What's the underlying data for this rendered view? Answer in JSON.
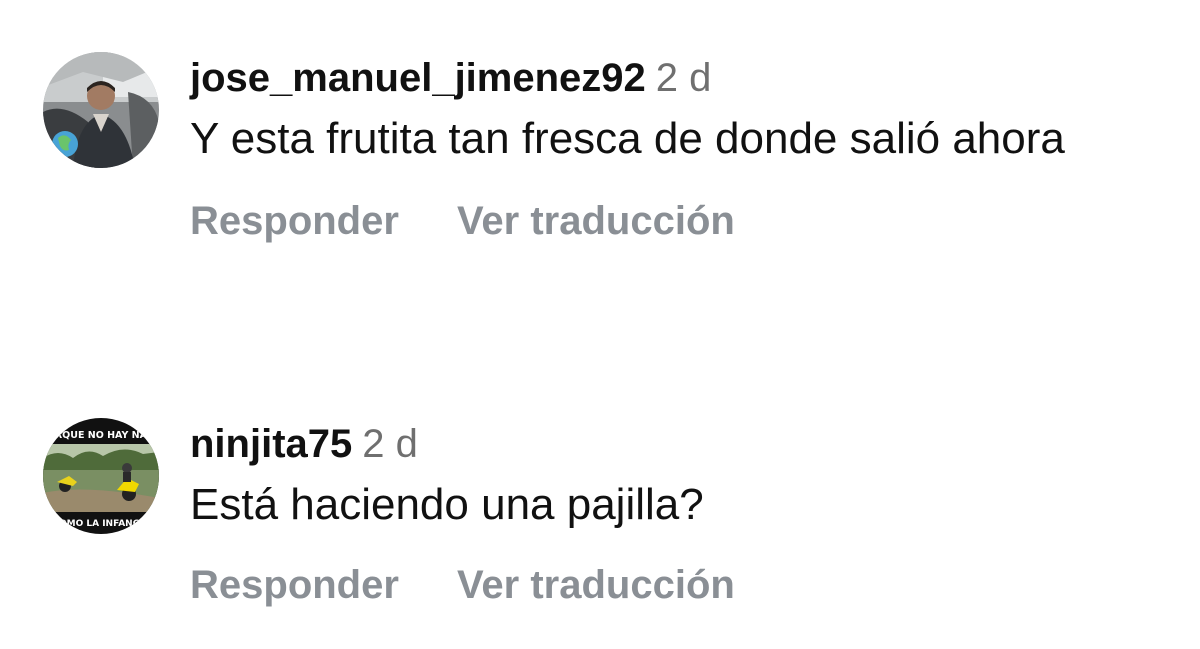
{
  "comments": [
    {
      "username": "jose_manuel_jimenez92",
      "time": "2 d",
      "text": "Y esta frutita  tan fresca de donde salió ahora",
      "reply_label": "Responder",
      "translate_label": "Ver traducción",
      "avatar_icon": "profile-photo"
    },
    {
      "username": "ninjita75",
      "time": "2 d",
      "text": "Está haciendo una pajilla?",
      "reply_label": "Responder",
      "translate_label": "Ver traducción",
      "avatar_icon": "meme-photo",
      "avatar_text_top": "PORQUE NO HAY NADA",
      "avatar_text_bottom": "COMO LA INFANCIA"
    }
  ],
  "colors": {
    "text": "#111111",
    "meta": "#6f6f6f",
    "action": "#8a8f95",
    "background": "#ffffff"
  }
}
